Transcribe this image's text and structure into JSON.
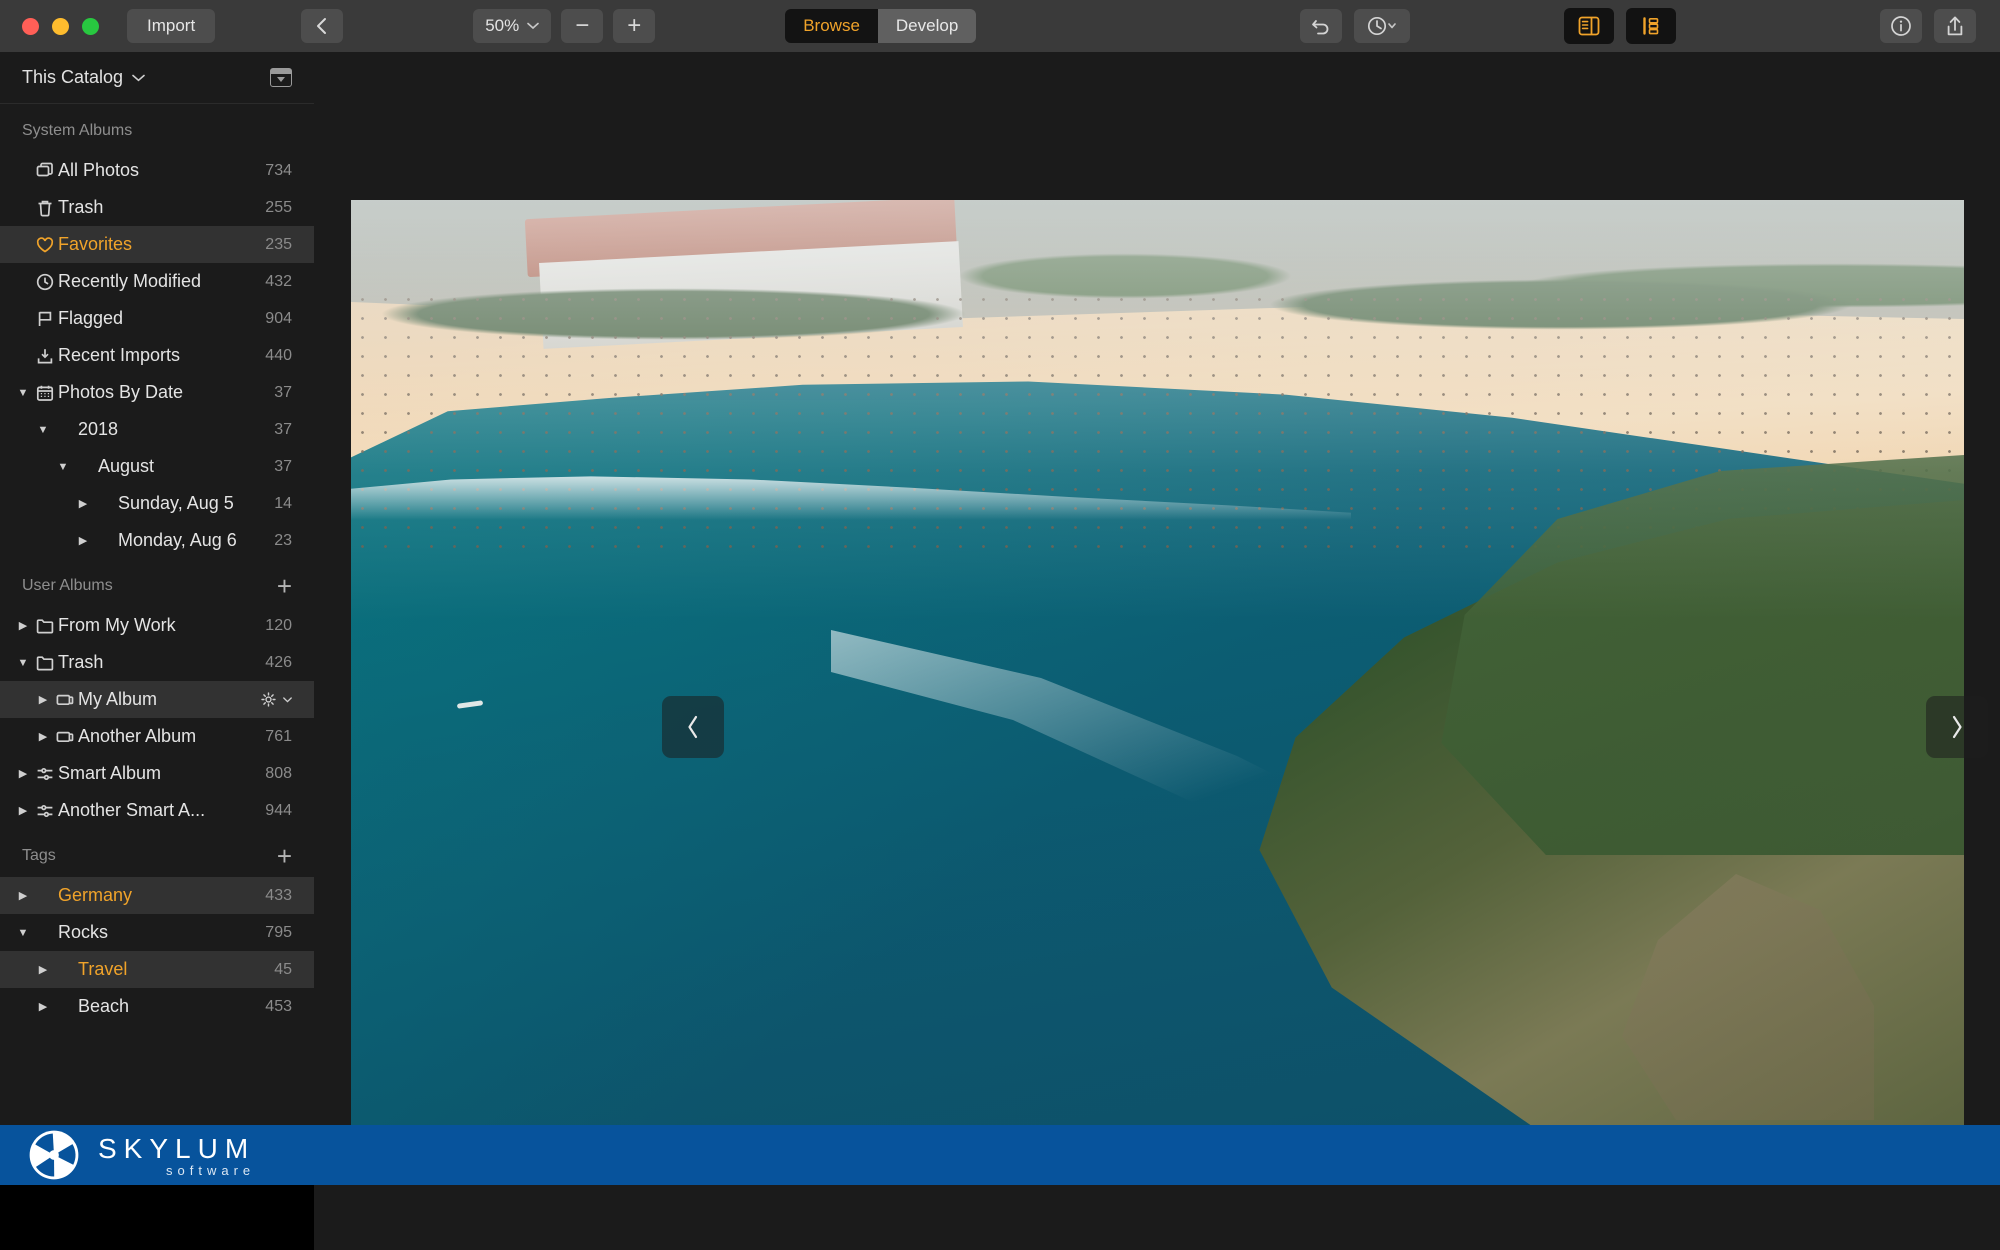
{
  "toolbar": {
    "import_label": "Import",
    "back_icon": "chevron-left-icon",
    "zoom_value": "50%",
    "zoom_out_label": "−",
    "zoom_in_label": "+",
    "modes": [
      {
        "label": "Browse",
        "active": true
      },
      {
        "label": "Develop",
        "active": false
      }
    ],
    "undo_icon": "undo-icon",
    "history_icon": "history-clock-icon",
    "panel_toggle_left_icon": "left-panel-icon",
    "panel_toggle_right_icon": "right-panel-icon",
    "info_icon": "info-icon",
    "share_icon": "share-icon"
  },
  "sidebar": {
    "catalog": {
      "label": "This Catalog",
      "chevron": "chevron-down-icon",
      "panel_icon": "catalog-panel-icon"
    },
    "sections": [
      {
        "title": "System Albums",
        "add_button": null,
        "items": [
          {
            "label": "All Photos",
            "count": "734",
            "icon": "photos-stack-icon",
            "indent": 0,
            "twisty": "",
            "accent": false,
            "selected": false
          },
          {
            "label": "Trash",
            "count": "255",
            "icon": "trash-icon",
            "indent": 0,
            "twisty": "",
            "accent": false,
            "selected": false
          },
          {
            "label": "Favorites",
            "count": "235",
            "icon": "heart-icon",
            "indent": 0,
            "twisty": "",
            "accent": true,
            "selected": true
          },
          {
            "label": "Recently Modified",
            "count": "432",
            "icon": "clock-icon",
            "indent": 0,
            "twisty": "",
            "accent": false,
            "selected": false
          },
          {
            "label": "Flagged",
            "count": "904",
            "icon": "flag-icon",
            "indent": 0,
            "twisty": "",
            "accent": false,
            "selected": false
          },
          {
            "label": "Recent Imports",
            "count": "440",
            "icon": "import-down-icon",
            "indent": 0,
            "twisty": "",
            "accent": false,
            "selected": false
          },
          {
            "label": "Photos By Date",
            "count": "37",
            "icon": "calendar-icon",
            "indent": 0,
            "twisty": "▼",
            "accent": false,
            "selected": false
          },
          {
            "label": "2018",
            "count": "37",
            "icon": "",
            "indent": 1,
            "twisty": "▼",
            "accent": false,
            "selected": false
          },
          {
            "label": "August",
            "count": "37",
            "icon": "",
            "indent": 2,
            "twisty": "▼",
            "accent": false,
            "selected": false
          },
          {
            "label": "Sunday, Aug 5",
            "count": "14",
            "icon": "",
            "indent": 3,
            "twisty": "▶",
            "accent": false,
            "selected": false
          },
          {
            "label": "Monday, Aug 6",
            "count": "23",
            "icon": "",
            "indent": 3,
            "twisty": "▶",
            "accent": false,
            "selected": false
          }
        ]
      },
      {
        "title": "User Albums",
        "add_button": "+",
        "items": [
          {
            "label": "From My Work",
            "count": "120",
            "icon": "folder-icon",
            "indent": 0,
            "twisty": "▶",
            "accent": false,
            "selected": false
          },
          {
            "label": "Trash",
            "count": "426",
            "icon": "folder-icon",
            "indent": 0,
            "twisty": "▼",
            "accent": false,
            "selected": false
          },
          {
            "label": "My Album",
            "count": "",
            "icon": "album-icon",
            "indent": 1,
            "twisty": "▶",
            "accent": false,
            "selected": true,
            "gear": true
          },
          {
            "label": "Another Album",
            "count": "761",
            "icon": "album-icon",
            "indent": 1,
            "twisty": "▶",
            "accent": false,
            "selected": false
          },
          {
            "label": "Smart Album",
            "count": "808",
            "icon": "smart-album-icon",
            "indent": 0,
            "twisty": "▶",
            "accent": false,
            "selected": false
          },
          {
            "label": "Another Smart A...",
            "count": "944",
            "icon": "smart-album-icon",
            "indent": 0,
            "twisty": "▶",
            "accent": false,
            "selected": false
          }
        ]
      },
      {
        "title": "Tags",
        "add_button": "+",
        "items": [
          {
            "label": "Germany",
            "count": "433",
            "icon": "",
            "indent": 0,
            "twisty": "▶",
            "accent": true,
            "selected": true
          },
          {
            "label": "Rocks",
            "count": "795",
            "icon": "",
            "indent": 0,
            "twisty": "▼",
            "accent": false,
            "selected": false
          },
          {
            "label": "Travel",
            "count": "45",
            "icon": "",
            "indent": 1,
            "twisty": "▶",
            "accent": true,
            "selected": true
          },
          {
            "label": "Beach",
            "count": "453",
            "icon": "",
            "indent": 1,
            "twisty": "▶",
            "accent": false,
            "selected": false
          }
        ]
      }
    ]
  },
  "viewer": {
    "prev_icon": "chevron-left-icon",
    "next_icon": "chevron-right-icon",
    "photo_alt": "aerial beach coastline photo"
  },
  "footer": {
    "brand": "SKYLUM",
    "brand_sub": "software",
    "logo_icon": "aperture-icon"
  },
  "colors": {
    "accent": "#f0a32a",
    "toolbar_bg": "#3a3a3a",
    "sidebar_bg": "#1b1b1b",
    "brand_blue": "#07539c",
    "selected_row": "#323232"
  }
}
